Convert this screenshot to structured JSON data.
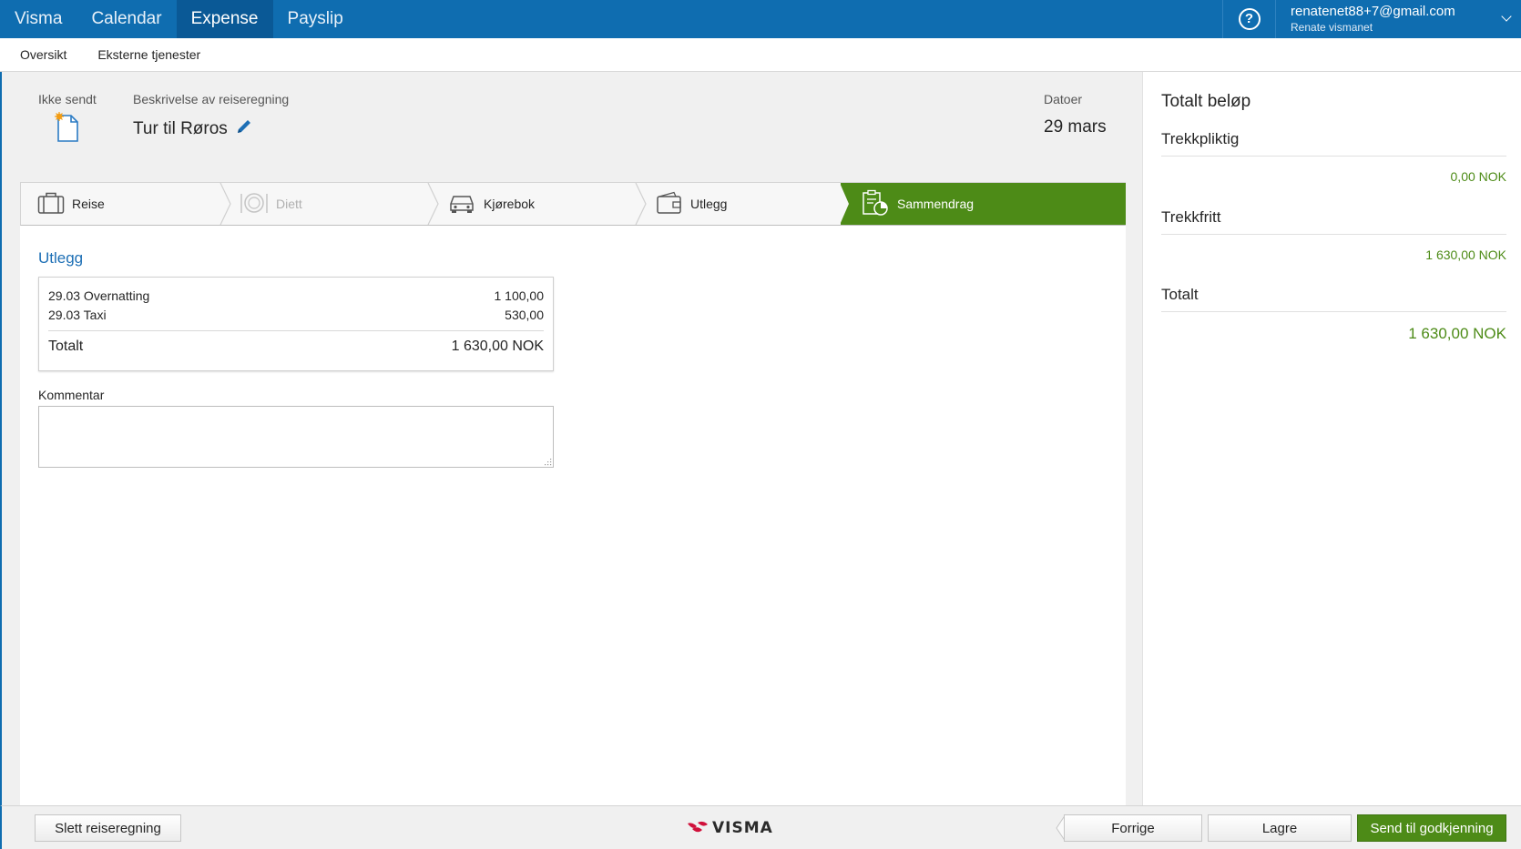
{
  "topnav": {
    "brand": "Visma",
    "items": [
      "Calendar",
      "Expense",
      "Payslip"
    ],
    "active": "Expense",
    "user": {
      "email": "renatenet88+7@gmail.com",
      "name": "Renate vismanet"
    }
  },
  "subnav": {
    "items": [
      "Oversikt",
      "Eksterne tjenester"
    ]
  },
  "header": {
    "status": "Ikke sendt",
    "description_label": "Beskrivelse av reiseregning",
    "title": "Tur til Røros",
    "dates_label": "Datoer",
    "dates_value": "29 mars"
  },
  "steps": [
    {
      "label": "Reise",
      "icon": "suitcase-icon",
      "state": "normal"
    },
    {
      "label": "Diett",
      "icon": "plate-icon",
      "state": "disabled"
    },
    {
      "label": "Kjørebok",
      "icon": "car-icon",
      "state": "normal"
    },
    {
      "label": "Utlegg",
      "icon": "wallet-icon",
      "state": "normal"
    },
    {
      "label": "Sammendrag",
      "icon": "clipboard-icon",
      "state": "active"
    }
  ],
  "expenses": {
    "title": "Utlegg",
    "items": [
      {
        "label": "29.03 Overnatting",
        "amount": "1 100,00"
      },
      {
        "label": "29.03 Taxi",
        "amount": "530,00"
      }
    ],
    "total_label": "Totalt",
    "total_value": "1 630,00 NOK"
  },
  "comment": {
    "label": "Kommentar",
    "value": ""
  },
  "summary": {
    "title": "Totalt beløp",
    "taxable_label": "Trekkpliktig",
    "taxable_value": "0,00 NOK",
    "taxfree_label": "Trekkfritt",
    "taxfree_value": "1 630,00 NOK",
    "total_label": "Totalt",
    "total_value": "1 630,00 NOK"
  },
  "footer": {
    "delete_label": "Slett reiseregning",
    "logo_text": "VISMA",
    "prev_label": "Forrige",
    "save_label": "Lagre",
    "send_label": "Send til godkjenning"
  },
  "colors": {
    "nav_blue": "#0f6db0",
    "accent_green": "#4d8b17",
    "link_blue": "#1d6fb5"
  }
}
